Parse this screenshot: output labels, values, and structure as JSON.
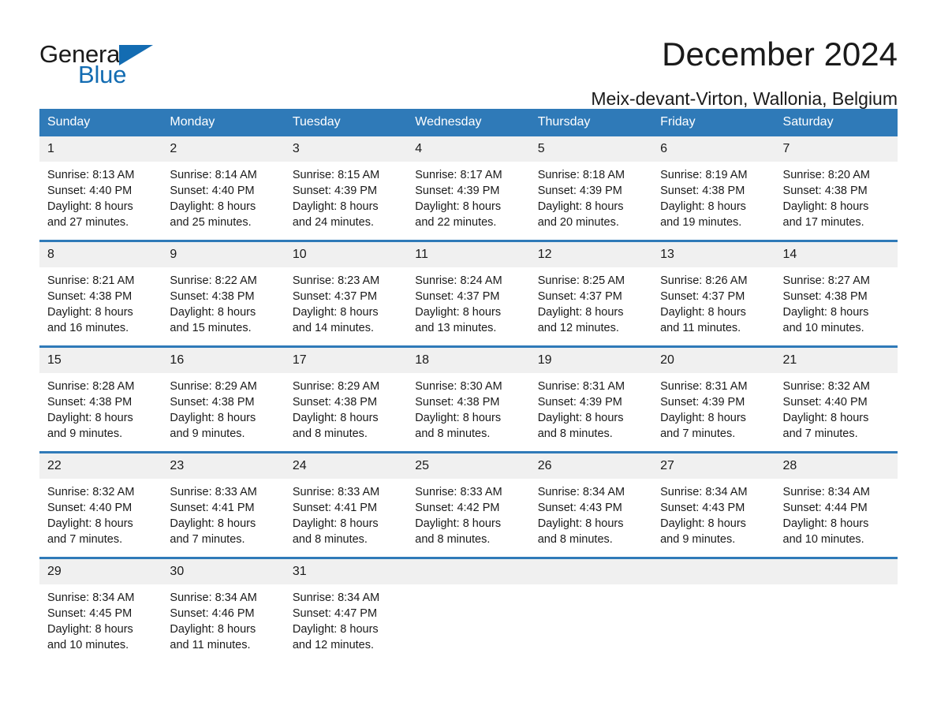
{
  "brand": {
    "name_part1": "General",
    "name_part2": "Blue",
    "flag_icon": "triangle-flag-icon",
    "accent_color": "#136cb2"
  },
  "header": {
    "title": "December 2024",
    "subtitle": "Meix-devant-Virton, Wallonia, Belgium"
  },
  "calendar": {
    "header_bg": "#2f7ab8",
    "daynum_bg": "#f0f0f0",
    "weekday_headers": [
      "Sunday",
      "Monday",
      "Tuesday",
      "Wednesday",
      "Thursday",
      "Friday",
      "Saturday"
    ],
    "weeks": [
      [
        {
          "day": "1",
          "sunrise": "Sunrise: 8:13 AM",
          "sunset": "Sunset: 4:40 PM",
          "daylight_line1": "Daylight: 8 hours",
          "daylight_line2": "and 27 minutes."
        },
        {
          "day": "2",
          "sunrise": "Sunrise: 8:14 AM",
          "sunset": "Sunset: 4:40 PM",
          "daylight_line1": "Daylight: 8 hours",
          "daylight_line2": "and 25 minutes."
        },
        {
          "day": "3",
          "sunrise": "Sunrise: 8:15 AM",
          "sunset": "Sunset: 4:39 PM",
          "daylight_line1": "Daylight: 8 hours",
          "daylight_line2": "and 24 minutes."
        },
        {
          "day": "4",
          "sunrise": "Sunrise: 8:17 AM",
          "sunset": "Sunset: 4:39 PM",
          "daylight_line1": "Daylight: 8 hours",
          "daylight_line2": "and 22 minutes."
        },
        {
          "day": "5",
          "sunrise": "Sunrise: 8:18 AM",
          "sunset": "Sunset: 4:39 PM",
          "daylight_line1": "Daylight: 8 hours",
          "daylight_line2": "and 20 minutes."
        },
        {
          "day": "6",
          "sunrise": "Sunrise: 8:19 AM",
          "sunset": "Sunset: 4:38 PM",
          "daylight_line1": "Daylight: 8 hours",
          "daylight_line2": "and 19 minutes."
        },
        {
          "day": "7",
          "sunrise": "Sunrise: 8:20 AM",
          "sunset": "Sunset: 4:38 PM",
          "daylight_line1": "Daylight: 8 hours",
          "daylight_line2": "and 17 minutes."
        }
      ],
      [
        {
          "day": "8",
          "sunrise": "Sunrise: 8:21 AM",
          "sunset": "Sunset: 4:38 PM",
          "daylight_line1": "Daylight: 8 hours",
          "daylight_line2": "and 16 minutes."
        },
        {
          "day": "9",
          "sunrise": "Sunrise: 8:22 AM",
          "sunset": "Sunset: 4:38 PM",
          "daylight_line1": "Daylight: 8 hours",
          "daylight_line2": "and 15 minutes."
        },
        {
          "day": "10",
          "sunrise": "Sunrise: 8:23 AM",
          "sunset": "Sunset: 4:37 PM",
          "daylight_line1": "Daylight: 8 hours",
          "daylight_line2": "and 14 minutes."
        },
        {
          "day": "11",
          "sunrise": "Sunrise: 8:24 AM",
          "sunset": "Sunset: 4:37 PM",
          "daylight_line1": "Daylight: 8 hours",
          "daylight_line2": "and 13 minutes."
        },
        {
          "day": "12",
          "sunrise": "Sunrise: 8:25 AM",
          "sunset": "Sunset: 4:37 PM",
          "daylight_line1": "Daylight: 8 hours",
          "daylight_line2": "and 12 minutes."
        },
        {
          "day": "13",
          "sunrise": "Sunrise: 8:26 AM",
          "sunset": "Sunset: 4:37 PM",
          "daylight_line1": "Daylight: 8 hours",
          "daylight_line2": "and 11 minutes."
        },
        {
          "day": "14",
          "sunrise": "Sunrise: 8:27 AM",
          "sunset": "Sunset: 4:38 PM",
          "daylight_line1": "Daylight: 8 hours",
          "daylight_line2": "and 10 minutes."
        }
      ],
      [
        {
          "day": "15",
          "sunrise": "Sunrise: 8:28 AM",
          "sunset": "Sunset: 4:38 PM",
          "daylight_line1": "Daylight: 8 hours",
          "daylight_line2": "and 9 minutes."
        },
        {
          "day": "16",
          "sunrise": "Sunrise: 8:29 AM",
          "sunset": "Sunset: 4:38 PM",
          "daylight_line1": "Daylight: 8 hours",
          "daylight_line2": "and 9 minutes."
        },
        {
          "day": "17",
          "sunrise": "Sunrise: 8:29 AM",
          "sunset": "Sunset: 4:38 PM",
          "daylight_line1": "Daylight: 8 hours",
          "daylight_line2": "and 8 minutes."
        },
        {
          "day": "18",
          "sunrise": "Sunrise: 8:30 AM",
          "sunset": "Sunset: 4:38 PM",
          "daylight_line1": "Daylight: 8 hours",
          "daylight_line2": "and 8 minutes."
        },
        {
          "day": "19",
          "sunrise": "Sunrise: 8:31 AM",
          "sunset": "Sunset: 4:39 PM",
          "daylight_line1": "Daylight: 8 hours",
          "daylight_line2": "and 8 minutes."
        },
        {
          "day": "20",
          "sunrise": "Sunrise: 8:31 AM",
          "sunset": "Sunset: 4:39 PM",
          "daylight_line1": "Daylight: 8 hours",
          "daylight_line2": "and 7 minutes."
        },
        {
          "day": "21",
          "sunrise": "Sunrise: 8:32 AM",
          "sunset": "Sunset: 4:40 PM",
          "daylight_line1": "Daylight: 8 hours",
          "daylight_line2": "and 7 minutes."
        }
      ],
      [
        {
          "day": "22",
          "sunrise": "Sunrise: 8:32 AM",
          "sunset": "Sunset: 4:40 PM",
          "daylight_line1": "Daylight: 8 hours",
          "daylight_line2": "and 7 minutes."
        },
        {
          "day": "23",
          "sunrise": "Sunrise: 8:33 AM",
          "sunset": "Sunset: 4:41 PM",
          "daylight_line1": "Daylight: 8 hours",
          "daylight_line2": "and 7 minutes."
        },
        {
          "day": "24",
          "sunrise": "Sunrise: 8:33 AM",
          "sunset": "Sunset: 4:41 PM",
          "daylight_line1": "Daylight: 8 hours",
          "daylight_line2": "and 8 minutes."
        },
        {
          "day": "25",
          "sunrise": "Sunrise: 8:33 AM",
          "sunset": "Sunset: 4:42 PM",
          "daylight_line1": "Daylight: 8 hours",
          "daylight_line2": "and 8 minutes."
        },
        {
          "day": "26",
          "sunrise": "Sunrise: 8:34 AM",
          "sunset": "Sunset: 4:43 PM",
          "daylight_line1": "Daylight: 8 hours",
          "daylight_line2": "and 8 minutes."
        },
        {
          "day": "27",
          "sunrise": "Sunrise: 8:34 AM",
          "sunset": "Sunset: 4:43 PM",
          "daylight_line1": "Daylight: 8 hours",
          "daylight_line2": "and 9 minutes."
        },
        {
          "day": "28",
          "sunrise": "Sunrise: 8:34 AM",
          "sunset": "Sunset: 4:44 PM",
          "daylight_line1": "Daylight: 8 hours",
          "daylight_line2": "and 10 minutes."
        }
      ],
      [
        {
          "day": "29",
          "sunrise": "Sunrise: 8:34 AM",
          "sunset": "Sunset: 4:45 PM",
          "daylight_line1": "Daylight: 8 hours",
          "daylight_line2": "and 10 minutes."
        },
        {
          "day": "30",
          "sunrise": "Sunrise: 8:34 AM",
          "sunset": "Sunset: 4:46 PM",
          "daylight_line1": "Daylight: 8 hours",
          "daylight_line2": "and 11 minutes."
        },
        {
          "day": "31",
          "sunrise": "Sunrise: 8:34 AM",
          "sunset": "Sunset: 4:47 PM",
          "daylight_line1": "Daylight: 8 hours",
          "daylight_line2": "and 12 minutes."
        },
        {
          "day": "",
          "sunrise": "",
          "sunset": "",
          "daylight_line1": "",
          "daylight_line2": ""
        },
        {
          "day": "",
          "sunrise": "",
          "sunset": "",
          "daylight_line1": "",
          "daylight_line2": ""
        },
        {
          "day": "",
          "sunrise": "",
          "sunset": "",
          "daylight_line1": "",
          "daylight_line2": ""
        },
        {
          "day": "",
          "sunrise": "",
          "sunset": "",
          "daylight_line1": "",
          "daylight_line2": ""
        }
      ]
    ]
  }
}
